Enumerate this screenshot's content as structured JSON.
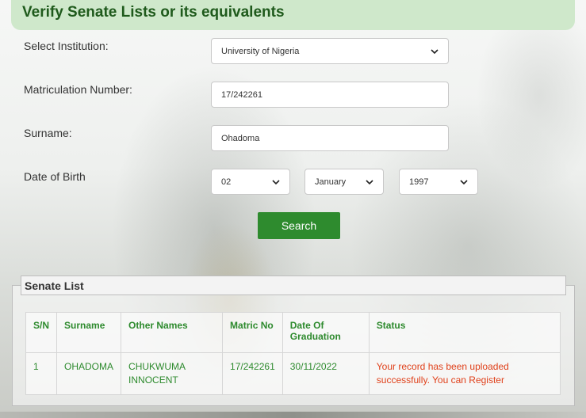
{
  "title": "Verify Senate Lists or its equivalents",
  "form": {
    "institution": {
      "label": "Select Institution:",
      "value": "University of Nigeria"
    },
    "matric": {
      "label": "Matriculation Number:",
      "value": "17/242261"
    },
    "surname": {
      "label": "Surname:",
      "value": "Ohadoma"
    },
    "dob": {
      "label": "Date of Birth",
      "day": "02",
      "month": "January",
      "year": "1997"
    },
    "search_label": "Search"
  },
  "senate_list": {
    "legend": "Senate List",
    "headers": [
      "S/N",
      "Surname",
      "Other Names",
      "Matric No",
      "Date Of Graduation",
      "Status"
    ],
    "rows": [
      {
        "sn": "1",
        "surname": "OHADOMA",
        "other_names": "CHUKWUMA INNOCENT",
        "matric_no": "17/242261",
        "graduation": "30/11/2022",
        "status": "Your record has been uploaded successfully. You can Register"
      }
    ]
  },
  "colors": {
    "header_bg": "#cfe8cb",
    "header_text": "#1f5a1c",
    "button": "#2e8b2e",
    "table_text": "#2d8a2d",
    "status_text": "#e0401a"
  },
  "icons": [
    "chevron-down-icon"
  ]
}
